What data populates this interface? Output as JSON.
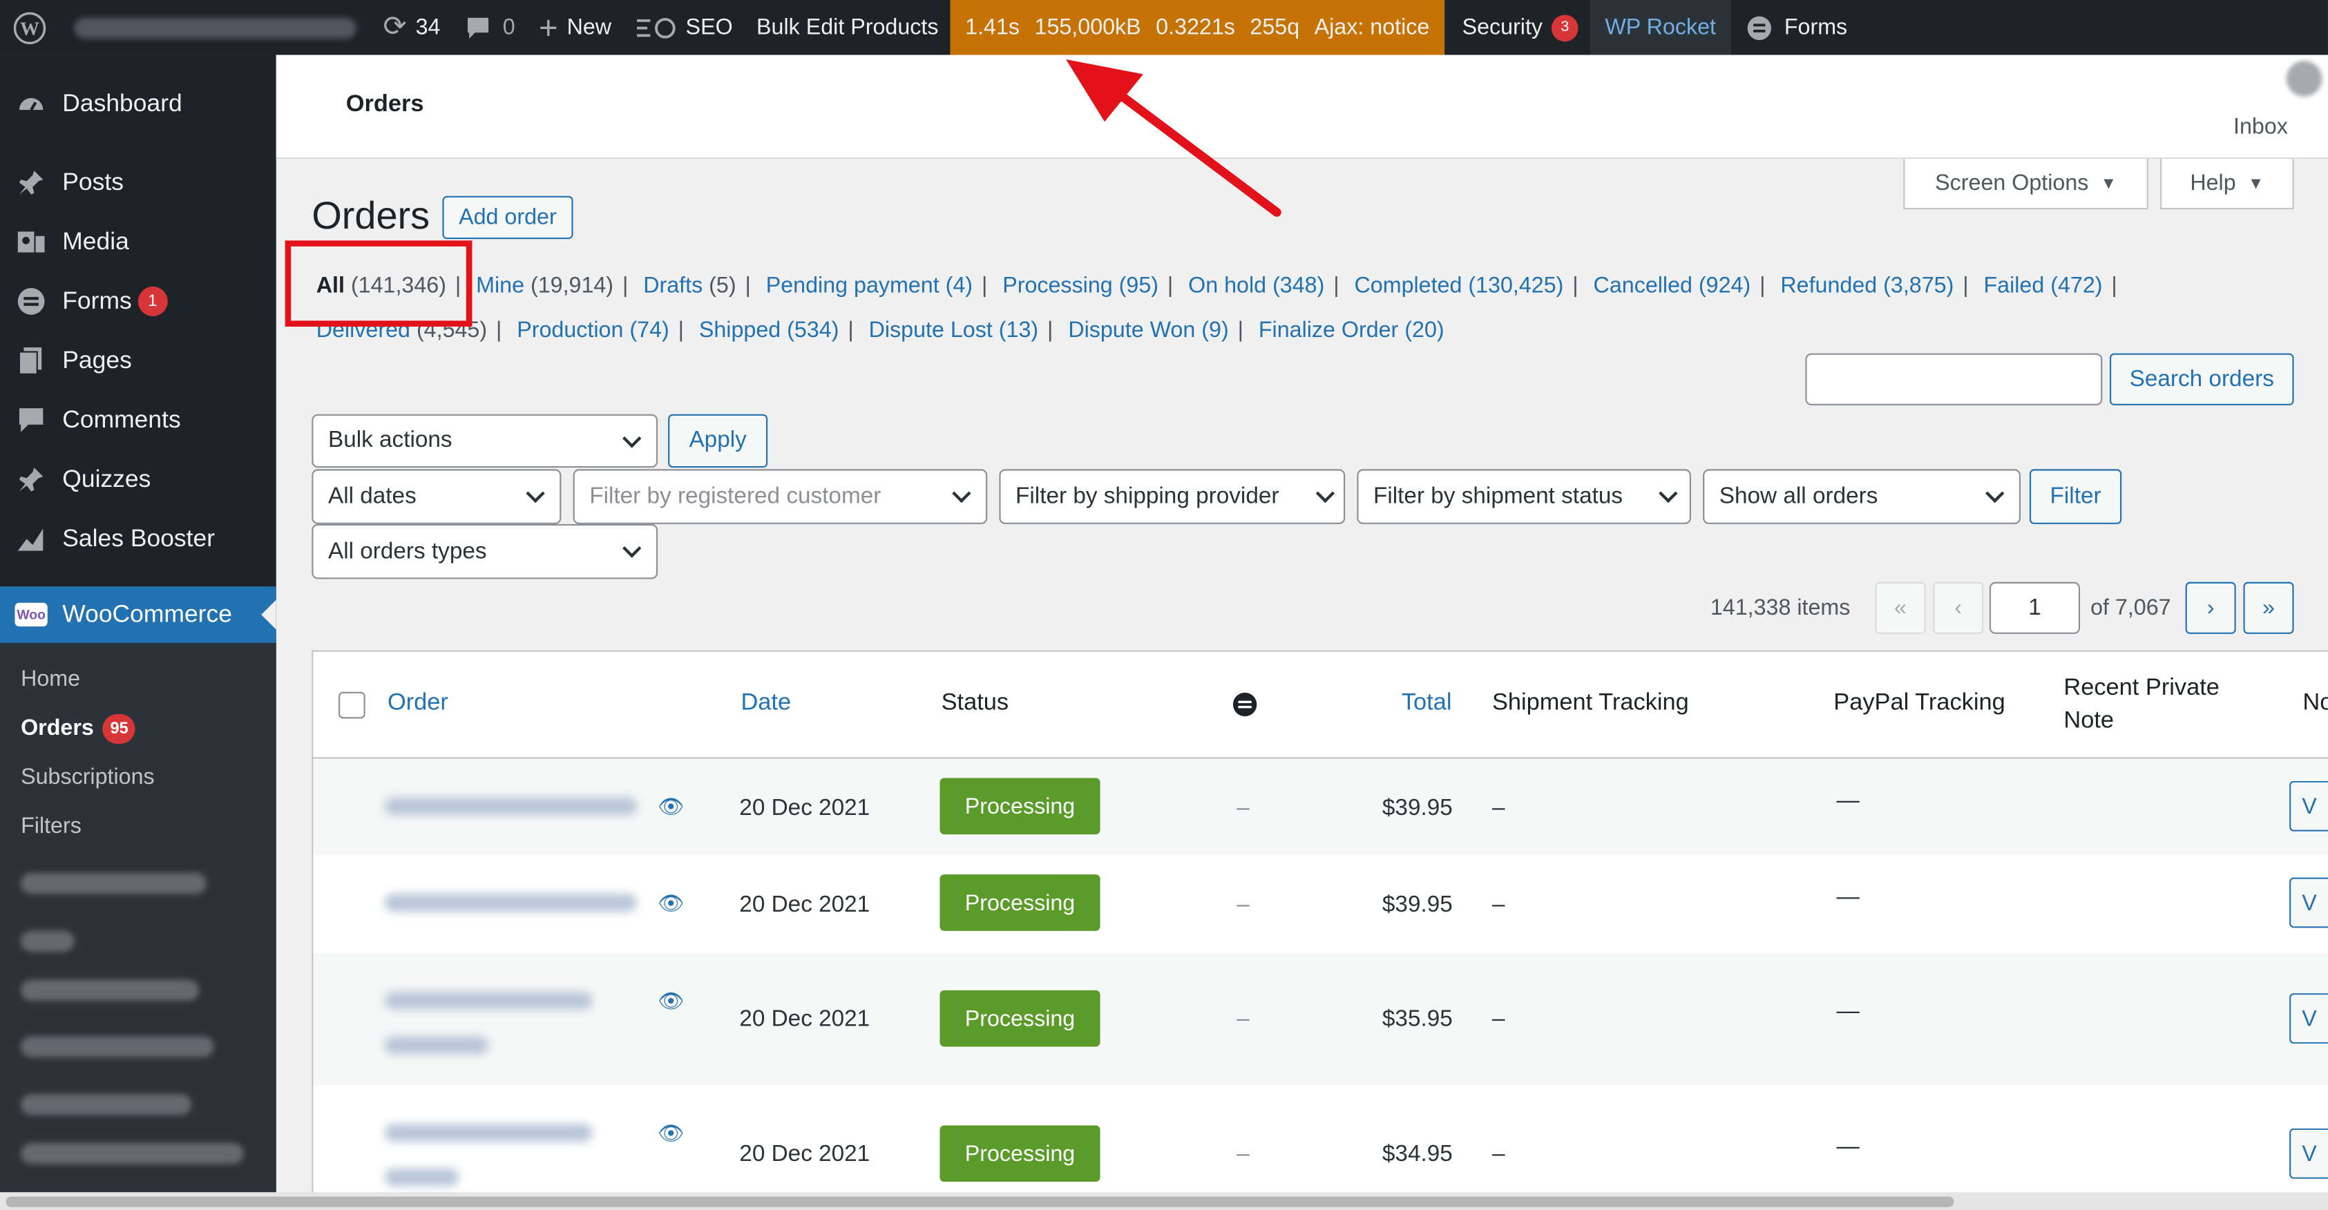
{
  "adminbar": {
    "updates_count": "34",
    "comments_count": "0",
    "new_label": "New",
    "seo_label": "SEO",
    "bulk_edit_label": "Bulk Edit Products",
    "perf_time": "1.41s",
    "perf_memory": "155,000kB",
    "perf_query_time": "0.3221s",
    "perf_queries": "255q",
    "perf_ajax": "Ajax: notice",
    "security_label": "Security",
    "security_count": "3",
    "wp_rocket_label": "WP Rocket",
    "forms_label": "Forms"
  },
  "sidebar": {
    "items": [
      {
        "label": "Dashboard",
        "icon": "dashboard-icon"
      },
      {
        "label": "Posts",
        "icon": "pin-icon"
      },
      {
        "label": "Media",
        "icon": "media-icon"
      },
      {
        "label": "Forms",
        "icon": "forms-icon",
        "badge": "1"
      },
      {
        "label": "Pages",
        "icon": "pages-icon"
      },
      {
        "label": "Comments",
        "icon": "comment-icon"
      },
      {
        "label": "Quizzes",
        "icon": "pin-icon"
      },
      {
        "label": "Sales Booster",
        "icon": "chart-icon"
      }
    ],
    "woocommerce_label": "WooCommerce",
    "woo_logo_text": "Woo",
    "submenu": {
      "home": "Home",
      "orders": "Orders",
      "orders_badge": "95",
      "subscriptions": "Subscriptions",
      "filters": "Filters"
    }
  },
  "header": {
    "title": "Orders",
    "inbox": "Inbox"
  },
  "screen_options_label": "Screen Options",
  "help_label": "Help",
  "page_title": "Orders",
  "add_order_label": "Add order",
  "views": [
    {
      "label": "All",
      "count": "(141,346)",
      "current": true
    },
    {
      "label": "Mine",
      "count": "(19,914)"
    },
    {
      "label": "Drafts",
      "count": "(5)"
    },
    {
      "label": "Pending payment",
      "count": "(4)"
    },
    {
      "label": "Processing",
      "count": "(95)"
    },
    {
      "label": "On hold",
      "count": "(348)"
    },
    {
      "label": "Completed",
      "count": "(130,425)"
    },
    {
      "label": "Cancelled",
      "count": "(924)"
    },
    {
      "label": "Refunded",
      "count": "(3,875)"
    },
    {
      "label": "Failed",
      "count": "(472)"
    },
    {
      "label": "Delivered",
      "count": "(4,545)"
    },
    {
      "label": "Production",
      "count": "(74)"
    },
    {
      "label": "Shipped",
      "count": "(534)"
    },
    {
      "label": "Dispute Lost",
      "count": "(13)"
    },
    {
      "label": "Dispute Won",
      "count": "(9)"
    },
    {
      "label": "Finalize Order",
      "count": "(20)"
    }
  ],
  "search_button_label": "Search orders",
  "search_value": "",
  "filters": {
    "bulk_actions": "Bulk actions",
    "apply_label": "Apply",
    "dates": "All dates",
    "customer_placeholder": "Filter by registered customer",
    "shipping_provider": "Filter by shipping provider",
    "shipment_status": "Filter by shipment status",
    "show_orders": "Show all orders",
    "filter_label": "Filter",
    "order_types": "All orders types"
  },
  "pagination": {
    "items": "141,338 items",
    "first": "«",
    "prev": "‹",
    "current_page": "1",
    "of_total": "of 7,067",
    "next": "›",
    "last": "»"
  },
  "table": {
    "columns": {
      "order": "Order",
      "date": "Date",
      "status": "Status",
      "total": "Total",
      "shipment_tracking": "Shipment Tracking",
      "paypal_tracking": "PayPal Tracking",
      "recent_note_line1": "Recent Private",
      "recent_note_line2": "Note",
      "next_col": "No"
    },
    "rows": [
      {
        "date": "20 Dec 2021",
        "status": "Processing",
        "dash": "–",
        "total": "$39.95",
        "tracking": "–",
        "paypal": "—",
        "action": "V"
      },
      {
        "date": "20 Dec 2021",
        "status": "Processing",
        "dash": "–",
        "total": "$39.95",
        "tracking": "–",
        "paypal": "—",
        "action": "V"
      },
      {
        "date": "20 Dec 2021",
        "status": "Processing",
        "dash": "–",
        "total": "$35.95",
        "tracking": "–",
        "paypal": "—",
        "action": "V"
      },
      {
        "date": "20 Dec 2021",
        "status": "Processing",
        "dash": "–",
        "total": "$34.95",
        "tracking": "–",
        "paypal": "—",
        "action": "V"
      }
    ]
  },
  "colors": {
    "admin_bar": "#1d2327",
    "perf_bar": "#c47304",
    "accent": "#2271b1",
    "status_processing": "#5b9b2a",
    "annotation_red": "#e2111a"
  }
}
